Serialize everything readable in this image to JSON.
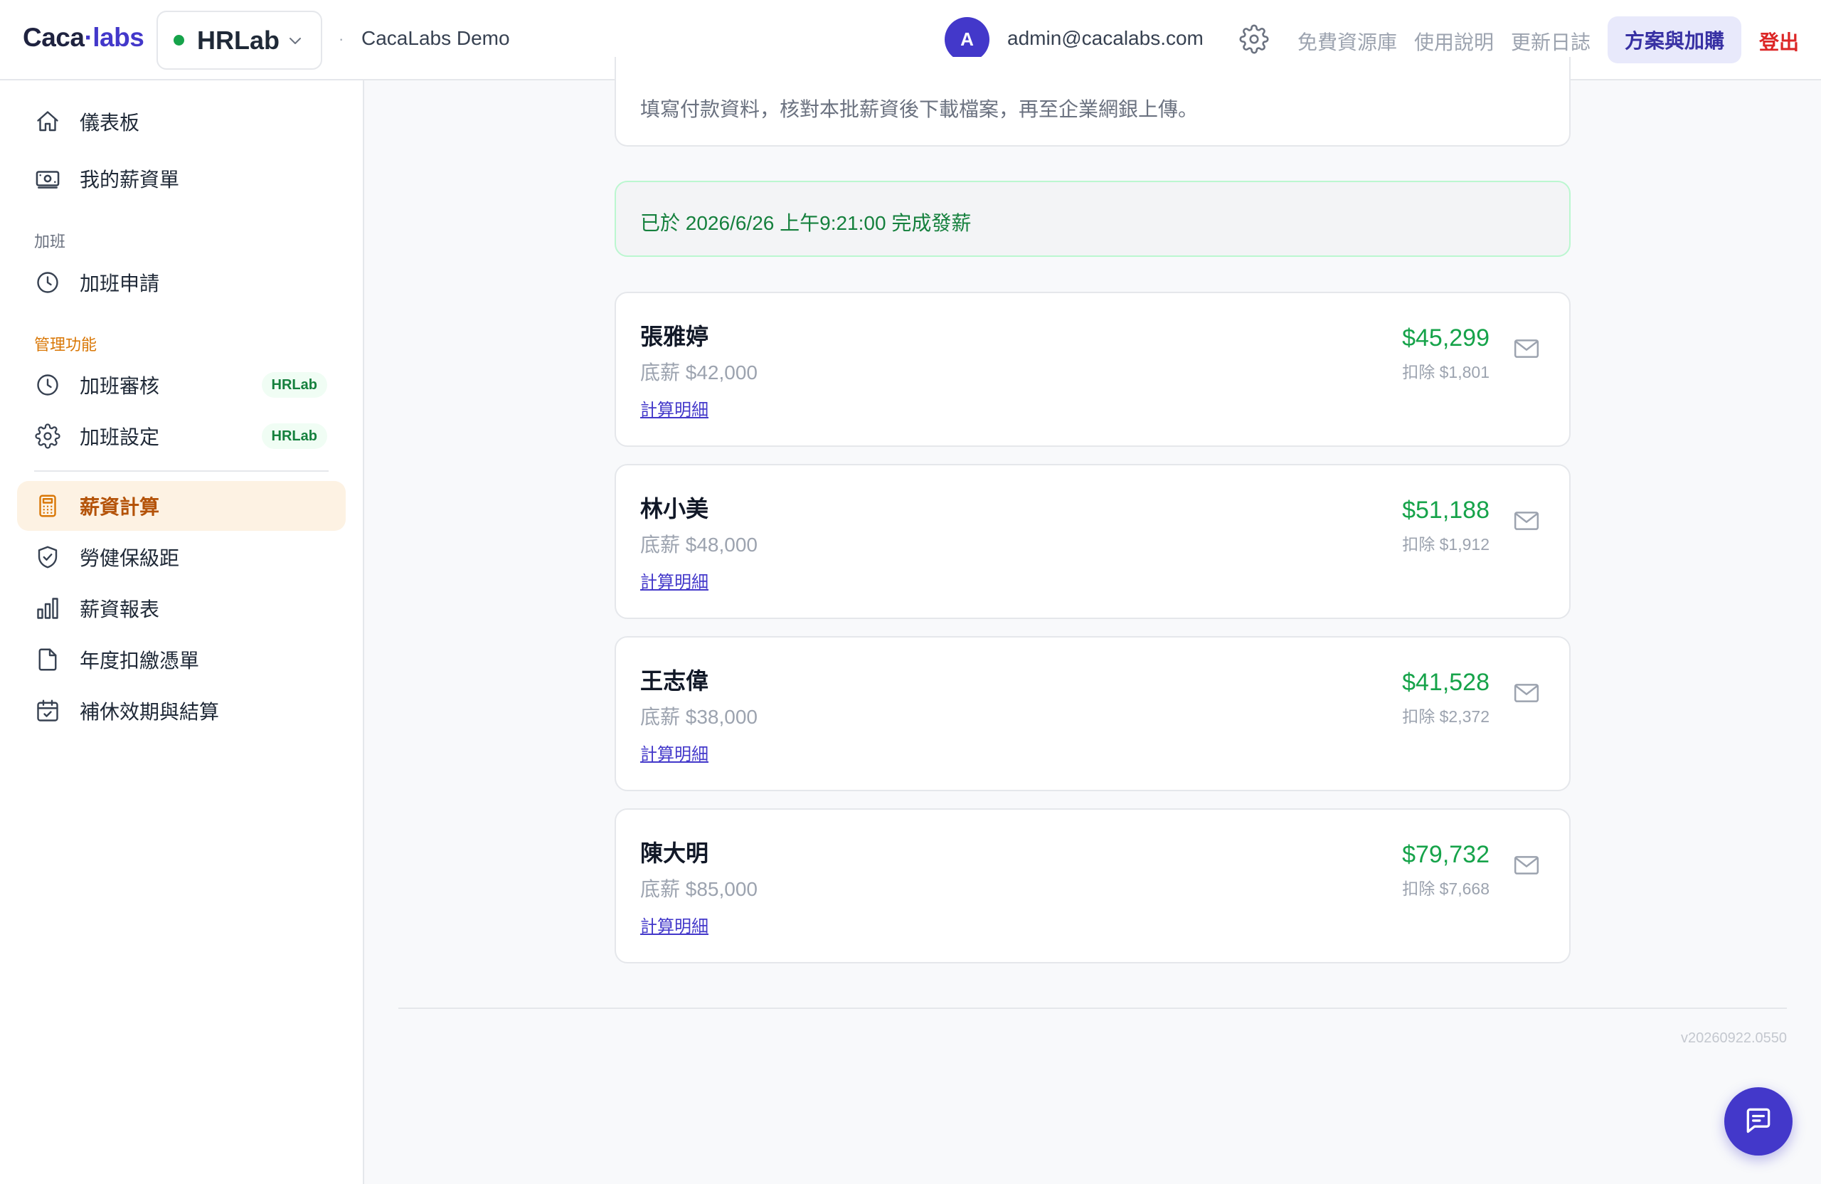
{
  "brand": {
    "logo_left": "Caca",
    "logo_dot": "·",
    "logo_right": "labs"
  },
  "header": {
    "app_name": "HRLab",
    "separator": "·",
    "org_name": "CacaLabs Demo",
    "avatar_initial": "A",
    "user_email": "admin@cacalabs.com",
    "links": {
      "free_resources": "免費資源庫",
      "manual": "使用說明",
      "changelog": "更新日誌"
    },
    "plan_button": "方案與加購",
    "logout": "登出"
  },
  "sidebar": {
    "dashboard": "儀表板",
    "my_payslip": "我的薪資單",
    "section_overtime": "加班",
    "overtime_request": "加班申請",
    "section_admin": "管理功能",
    "overtime_review": "加班審核",
    "overtime_settings": "加班設定",
    "badge": "HRLab",
    "payroll": "薪資計算",
    "insurance": "勞健保級距",
    "reports": "薪資報表",
    "withholding": "年度扣繳憑單",
    "comp_leave": "補休效期與結算"
  },
  "main": {
    "instruction": "填寫付款資料，核對本批薪資後下載檔案，再至企業網銀上傳。",
    "completed_message": "已於 2026/6/26 上午9:21:00 完成發薪",
    "detail_link": "計算明細",
    "employees": [
      {
        "name": "張雅婷",
        "base": "底薪 $42,000",
        "net": "$45,299",
        "deduction": "扣除 $1,801"
      },
      {
        "name": "林小美",
        "base": "底薪 $48,000",
        "net": "$51,188",
        "deduction": "扣除 $1,912"
      },
      {
        "name": "王志偉",
        "base": "底薪 $38,000",
        "net": "$41,528",
        "deduction": "扣除 $2,372"
      },
      {
        "name": "陳大明",
        "base": "底薪 $85,000",
        "net": "$79,732",
        "deduction": "扣除 $7,668"
      }
    ]
  },
  "footer": {
    "version": "v20260922.0550"
  },
  "colors": {
    "accent": "#4338ca",
    "success": "#16a34a",
    "active_nav_bg": "#fdf2e3",
    "active_nav_text": "#b45309",
    "danger": "#dc2626"
  },
  "icons": [
    "home-icon",
    "payslip-icon",
    "clock-icon",
    "gear-icon",
    "calculator-icon",
    "shield-icon",
    "bar-chart-icon",
    "document-icon",
    "calendar-icon",
    "mail-icon",
    "chat-icon",
    "chevron-down-icon"
  ]
}
